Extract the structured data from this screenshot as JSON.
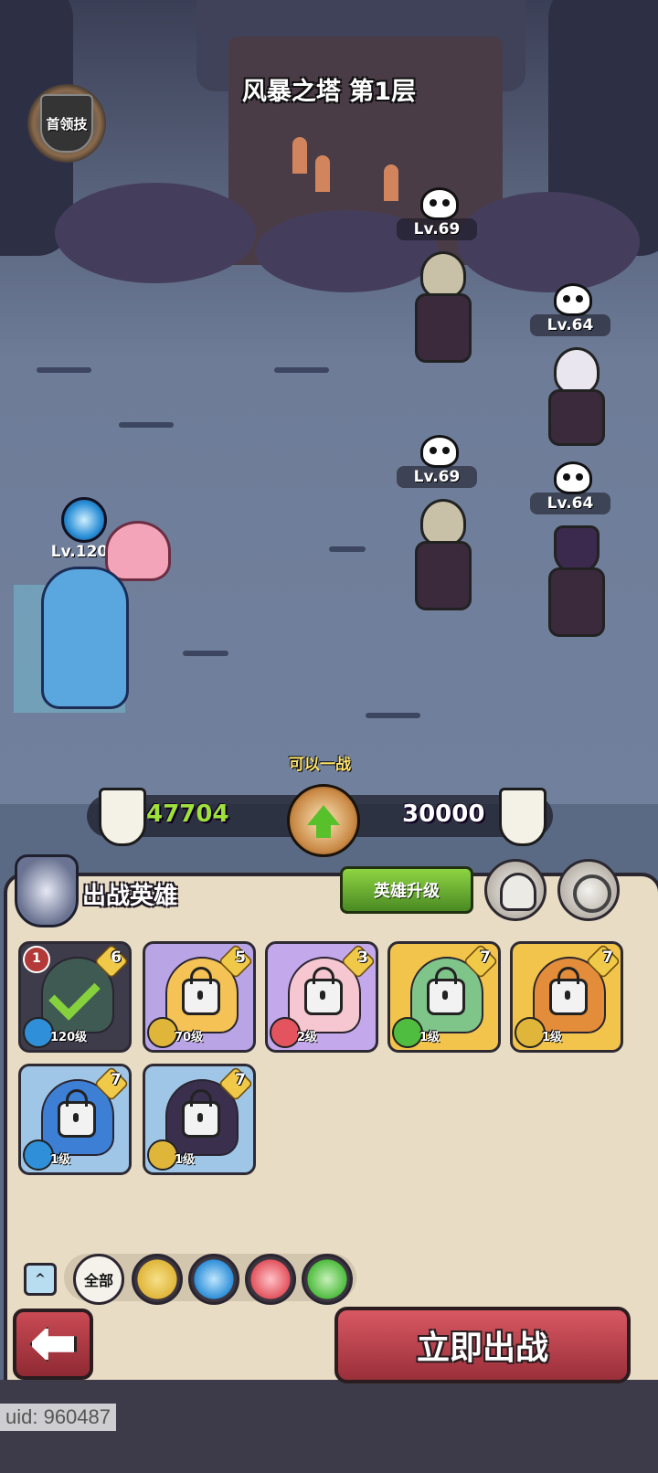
{
  "stage": {
    "title": "风暴之塔 第1层",
    "boss_badge": "首领技"
  },
  "enemies": [
    {
      "level": "Lv.69"
    },
    {
      "level": "Lv.64"
    },
    {
      "level": "Lv.69"
    },
    {
      "level": "Lv.64"
    }
  ],
  "player_hero": {
    "level": "Lv.120"
  },
  "battle": {
    "status": "可以一战",
    "player_power": "47704",
    "enemy_power": "30000"
  },
  "team_panel": {
    "title": "出战英雄",
    "upgrade_label": "英雄升级"
  },
  "heroes": [
    {
      "stars": "6",
      "level": "120级",
      "selected": true,
      "rank": "1",
      "element": "water"
    },
    {
      "stars": "5",
      "level": "70级",
      "selected": false,
      "element": "earth"
    },
    {
      "stars": "3",
      "level": "2级",
      "selected": false,
      "element": "fire"
    },
    {
      "stars": "7",
      "level": "1级",
      "selected": false,
      "element": "wind"
    },
    {
      "stars": "7",
      "level": "1级",
      "selected": false,
      "element": "earth"
    },
    {
      "stars": "7",
      "level": "1级",
      "selected": false,
      "element": "water"
    },
    {
      "stars": "7",
      "level": "1级",
      "selected": false,
      "element": "earth"
    }
  ],
  "filters": {
    "all_label": "全部",
    "collapse_label": "^"
  },
  "actions": {
    "go_label": "立即出战"
  },
  "footer": {
    "uid": "uid: 960487"
  },
  "colors": {
    "water": "#2f8fd8",
    "earth": "#e0b63a",
    "fire": "#e3545e",
    "wind": "#4fbd3f"
  }
}
